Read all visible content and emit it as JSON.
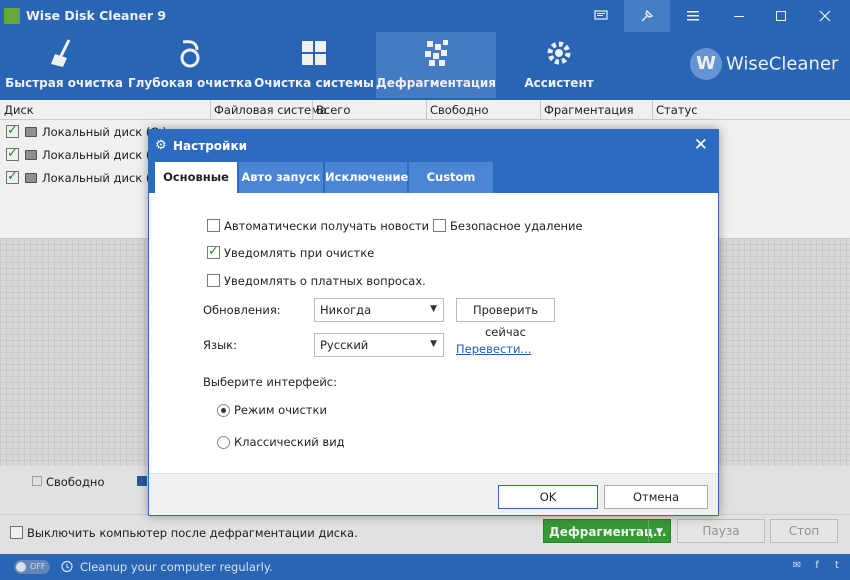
{
  "window": {
    "title": "Wise Disk Cleaner 9",
    "brand": "WiseCleaner",
    "brand_letter": "W"
  },
  "toolbar": {
    "items": [
      {
        "label": "Быстрая очистка",
        "icon": "broom-icon"
      },
      {
        "label": "Глубокая очистка",
        "icon": "vacuum-icon"
      },
      {
        "label": "Очистка системы",
        "icon": "windows-icon"
      },
      {
        "label": "Дефрагментация",
        "icon": "defrag-icon",
        "active": true
      },
      {
        "label": "Ассистент",
        "icon": "gear-icon"
      }
    ]
  },
  "table": {
    "columns": [
      "Диск",
      "Файловая система",
      "Всего",
      "Свободно",
      "Фрагментация",
      "Статус"
    ],
    "rows": [
      {
        "name": "Локальный диск (C:)",
        "checked": true
      },
      {
        "name": "Локальный диск (D:)",
        "checked": true
      },
      {
        "name": "Локальный диск (E:)",
        "checked": true
      }
    ]
  },
  "legend": {
    "free": "Свободно"
  },
  "bottom": {
    "shutdown_label": "Выключить компьютер после дефрагментации диска.",
    "defrag_button": "Дефрагментац...",
    "pause_button": "Пауза",
    "stop_button": "Стоп"
  },
  "statusbar": {
    "toggle": "OFF",
    "message": "Cleanup your computer regularly."
  },
  "dialog": {
    "title": "Настройки",
    "tabs": [
      "Основные",
      "Авто запуск",
      "Исключение",
      "Custom"
    ],
    "active_tab": 0,
    "options": {
      "auto_news": {
        "label": "Автоматически получать новости",
        "checked": false
      },
      "safe_delete": {
        "label": "Безопасное удаление",
        "checked": false
      },
      "notify_clean": {
        "label": "Уведомлять при очистке",
        "checked": true
      },
      "notify_paid": {
        "label": "Уведомлять о платных вопросах.",
        "checked": false
      }
    },
    "updates_label": "Обновления:",
    "updates_value": "Никогда",
    "check_now": "Проверить сейчас",
    "language_label": "Язык:",
    "language_value": "Русский",
    "translate_link": "Перевести...",
    "interface_label": "Выберите интерфейс:",
    "interface_options": [
      {
        "label": "Режим очистки",
        "selected": true
      },
      {
        "label": "Классический вид",
        "selected": false
      }
    ],
    "ok": "OK",
    "cancel": "Отмена"
  }
}
